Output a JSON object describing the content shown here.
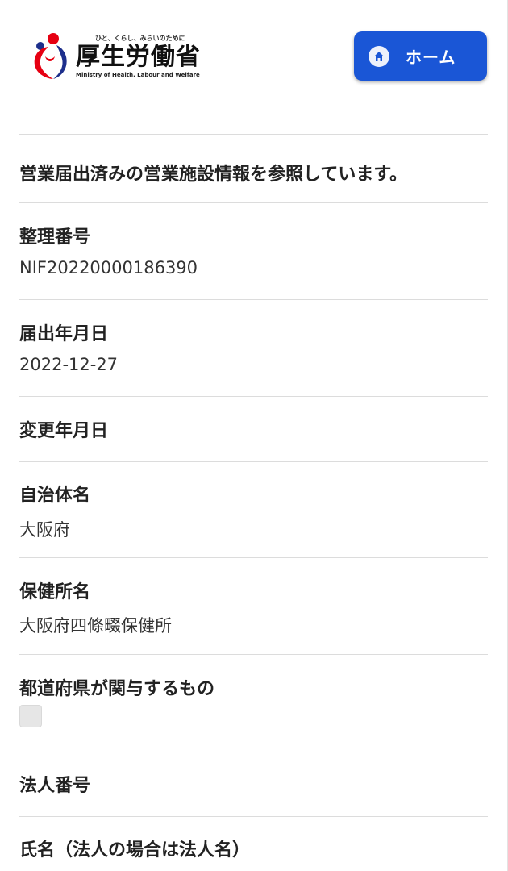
{
  "header": {
    "logo_tagline": "ひと、くらし、みらいのために",
    "logo_name": "厚生労働省",
    "logo_english": "Ministry of Health, Labour and Welfare",
    "home_button_label": "ホーム"
  },
  "intro_text": "営業届出済みの営業施設情報を参照しています。",
  "fields": [
    {
      "label": "整理番号",
      "value": "NIF20220000186390"
    },
    {
      "label": "届出年月日",
      "value": "2022-12-27"
    },
    {
      "label": "変更年月日",
      "value": ""
    },
    {
      "label": "自治体名",
      "value": "大阪府"
    },
    {
      "label": "保健所名",
      "value": "大阪府四條畷保健所"
    },
    {
      "label": "都道府県が関与するもの",
      "checked": false
    },
    {
      "label": "法人番号",
      "value": ""
    },
    {
      "label": "氏名（法人の場合は法人名）",
      "value": ""
    }
  ],
  "colors": {
    "home_button": "#1a56d6",
    "logo_red": "#e60012",
    "logo_blue": "#1d2f8c"
  }
}
